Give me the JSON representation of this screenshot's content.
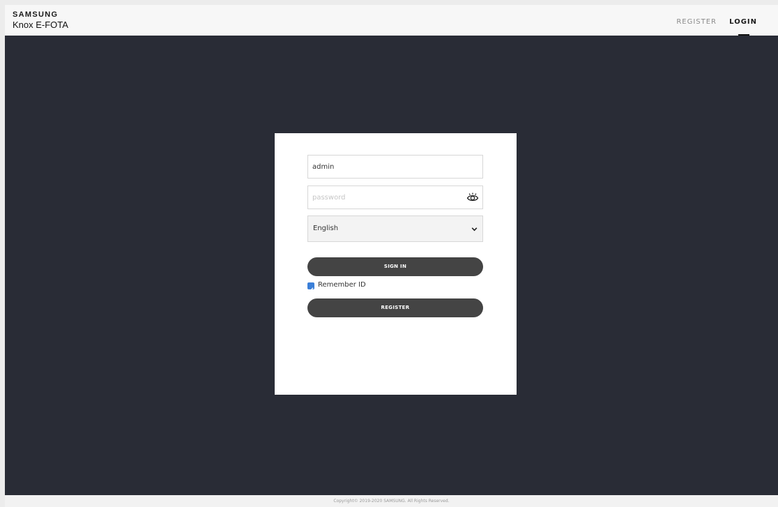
{
  "header": {
    "brand": "SAMSUNG",
    "product": "Knox E-FOTA",
    "nav": {
      "register": "REGISTER",
      "login": "LOGIN"
    }
  },
  "login_form": {
    "id_value": "admin",
    "password_placeholder": "password",
    "language_selected": "English",
    "sign_in_label": "SIGN IN",
    "remember_id_label": "Remember ID",
    "remember_id_checked": true,
    "register_label": "REGISTER"
  },
  "footer": {
    "copyright": "Copyright© 2019-2020 SAMSUNG. All Rights Reserved."
  },
  "colors": {
    "background_dark": "#292c36",
    "button": "#444444",
    "checkbox": "#3b7fd8"
  }
}
